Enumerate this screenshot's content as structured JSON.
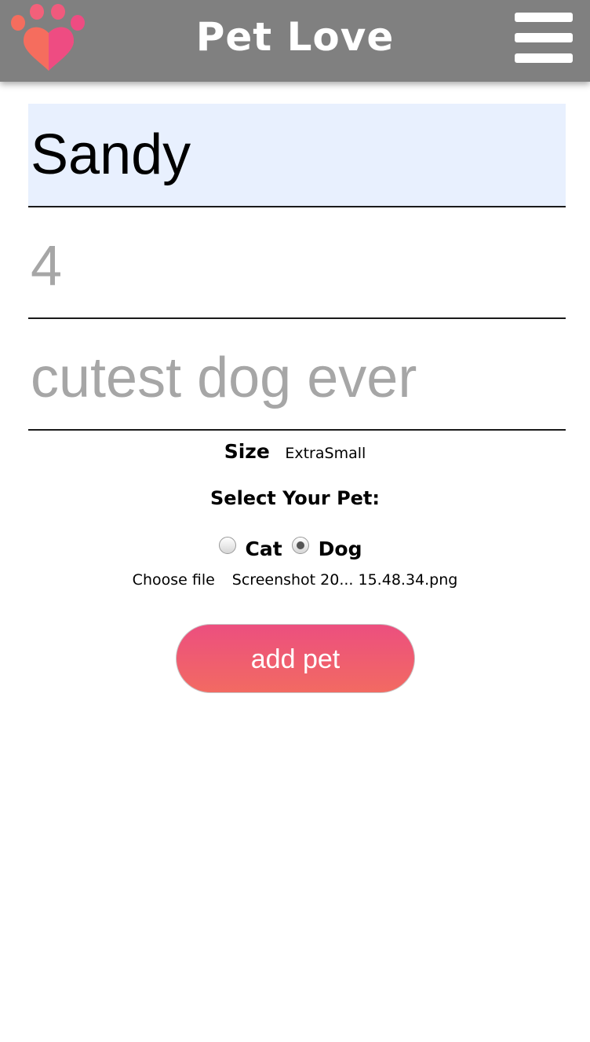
{
  "header": {
    "title": "Pet Love",
    "logo_icon": "paw-heart-icon",
    "menu_icon": "hamburger-menu-icon"
  },
  "form": {
    "name_value": "Sandy",
    "age_placeholder": "4",
    "description_placeholder": "cutest dog ever",
    "size_label": "Size",
    "size_value": "ExtraSmall",
    "select_pet_label": "Select Your Pet:",
    "pet_options": [
      {
        "label": "Cat",
        "checked": false
      },
      {
        "label": "Dog",
        "checked": true
      }
    ],
    "file_button_label": "Choose file",
    "file_name": "Screenshot 20... 15.48.34.png",
    "submit_label": "add pet"
  },
  "colors": {
    "header_bg": "#808080",
    "name_field_bg": "#e8f0fe",
    "button_gradient_top": "#ec4f7f",
    "button_gradient_bottom": "#f26a62",
    "paw_pink": "#ee4c82",
    "paw_coral": "#f56d5e"
  }
}
